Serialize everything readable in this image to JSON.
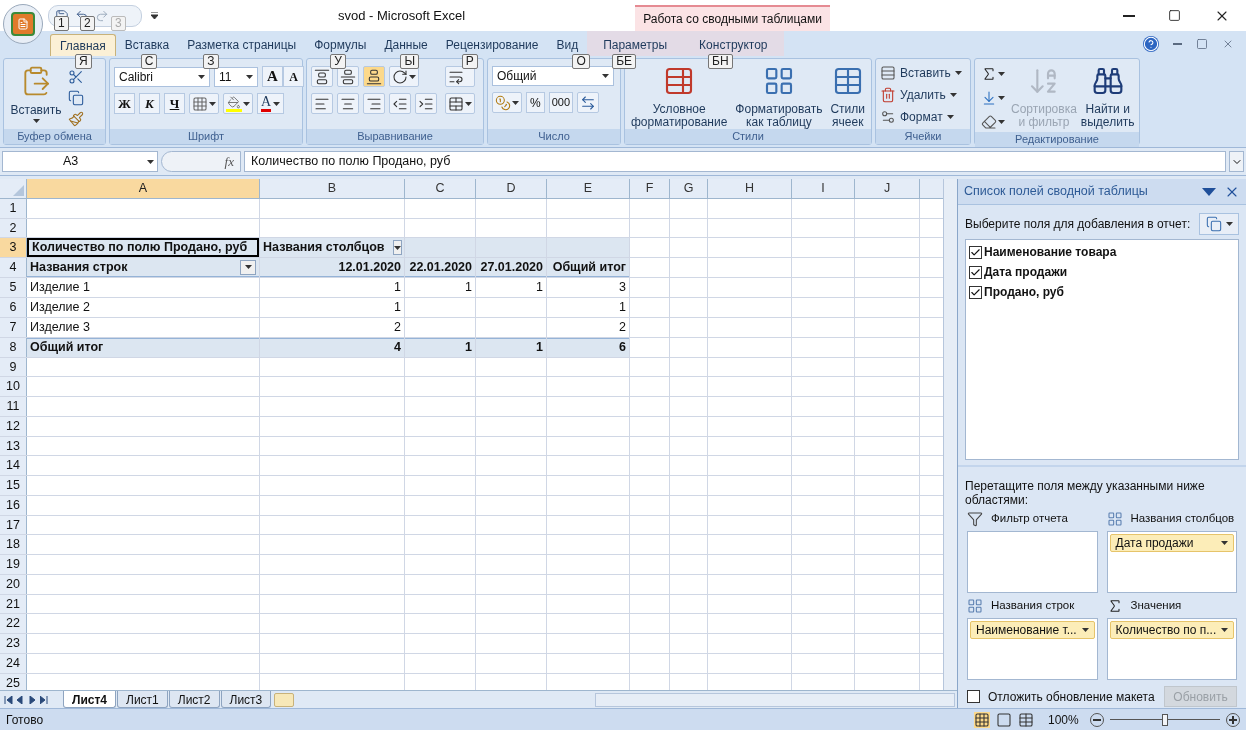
{
  "window": {
    "title": "svod - Microsoft Excel",
    "context_group": "Работа со сводными таблицами"
  },
  "quick_access_keytips": [
    "1",
    "2",
    "3"
  ],
  "ribbon_tabs": [
    {
      "label": "Главная",
      "selected": true,
      "contextual": false,
      "keytip": "Я"
    },
    {
      "label": "Вставка",
      "selected": false,
      "contextual": false,
      "keytip": "С"
    },
    {
      "label": "Разметка страницы",
      "selected": false,
      "contextual": false,
      "keytip": "З"
    },
    {
      "label": "Формулы",
      "selected": false,
      "contextual": false,
      "keytip": "У"
    },
    {
      "label": "Данные",
      "selected": false,
      "contextual": false,
      "keytip": "Ы"
    },
    {
      "label": "Рецензирование",
      "selected": false,
      "contextual": false,
      "keytip": "Р"
    },
    {
      "label": "Вид",
      "selected": false,
      "contextual": false,
      "keytip": "О"
    },
    {
      "label": "Параметры",
      "selected": false,
      "contextual": true,
      "keytip": "БЕ"
    },
    {
      "label": "Конструктор",
      "selected": false,
      "contextual": true,
      "keytip": "БН"
    }
  ],
  "clipboard": {
    "label": "Буфер обмена",
    "paste": "Вставить"
  },
  "font": {
    "label": "Шрифт",
    "name": "Calibri",
    "size": "11",
    "grow": "A",
    "shrink": "A",
    "bold": "Ж",
    "italic": "К",
    "underline": "Ч",
    "color_glyph": "A"
  },
  "alignment": {
    "label": "Выравнивание"
  },
  "number": {
    "label": "Число",
    "format": "Общий",
    "percent": "%",
    "thousands": "000"
  },
  "styles": {
    "label": "Стили",
    "buttons": [
      "Условное\nформатирование",
      "Форматировать\nкак таблицу",
      "Стили\nячеек"
    ]
  },
  "cells": {
    "label": "Ячейки",
    "buttons": [
      "Вставить",
      "Удалить",
      "Формат"
    ]
  },
  "editing": {
    "label": "Редактирование",
    "sort": {
      "label": "Сортировка\nи фильтр",
      "disabled": true
    },
    "find": {
      "label": "Найти и\nвыделить",
      "disabled": false
    }
  },
  "formula_bar": {
    "name_box": "A3",
    "fx": "fx",
    "value": "Количество по полю Продано, руб"
  },
  "sheet": {
    "columns": [
      {
        "label": "A",
        "selected": true
      },
      {
        "label": "B",
        "selected": false
      },
      {
        "label": "C",
        "selected": false
      },
      {
        "label": "D",
        "selected": false
      },
      {
        "label": "E",
        "selected": false
      },
      {
        "label": "F",
        "selected": false
      },
      {
        "label": "G",
        "selected": false
      },
      {
        "label": "H",
        "selected": false
      },
      {
        "label": "I",
        "selected": false
      },
      {
        "label": "J",
        "selected": false
      }
    ],
    "rows": [
      {
        "label": "1",
        "selected": false
      },
      {
        "label": "2",
        "selected": false
      },
      {
        "label": "3",
        "selected": true
      },
      {
        "label": "4",
        "selected": false
      },
      {
        "label": "5",
        "selected": false
      },
      {
        "label": "6",
        "selected": false
      },
      {
        "label": "7",
        "selected": false
      },
      {
        "label": "8",
        "selected": false
      },
      {
        "label": "9",
        "selected": false
      },
      {
        "label": "10",
        "selected": false
      },
      {
        "label": "11",
        "selected": false
      },
      {
        "label": "12",
        "selected": false
      },
      {
        "label": "13",
        "selected": false
      },
      {
        "label": "14",
        "selected": false
      },
      {
        "label": "15",
        "selected": false
      },
      {
        "label": "16",
        "selected": false
      },
      {
        "label": "17",
        "selected": false
      },
      {
        "label": "18",
        "selected": false
      },
      {
        "label": "19",
        "selected": false
      },
      {
        "label": "20",
        "selected": false
      },
      {
        "label": "21",
        "selected": false
      },
      {
        "label": "22",
        "selected": false
      },
      {
        "label": "23",
        "selected": false
      },
      {
        "label": "24",
        "selected": false
      },
      {
        "label": "25",
        "selected": false
      }
    ],
    "pivot": {
      "data_field": "Количество по полю Продано, руб",
      "column_labels": "Названия столбцов",
      "row_labels": "Названия строк",
      "headers": [
        "12.01.2020",
        "22.01.2020",
        "27.01.2020",
        "Общий итог"
      ],
      "items": [
        {
          "label": "Изделие 1",
          "date_1": "1",
          "date_2": "1",
          "date_3": "1",
          "total": "3"
        },
        {
          "label": "Изделие 2",
          "date_1": "1",
          "total": "1"
        },
        {
          "label": "Изделие 3",
          "date_1": "2",
          "total": "2"
        }
      ],
      "grand_total": {
        "label": "Общий итог",
        "date_1": "4",
        "date_2": "1",
        "date_3": "1",
        "total": "6"
      }
    }
  },
  "sheet_tabs": [
    {
      "label": "Лист4",
      "selected": true
    },
    {
      "label": "Лист1",
      "selected": false
    },
    {
      "label": "Лист2",
      "selected": false
    },
    {
      "label": "Лист3",
      "selected": false
    }
  ],
  "field_list": {
    "title": "Список полей сводной таблицы",
    "prompt": "Выберите поля для добавления в отчет:",
    "fields": [
      {
        "label": "Наименование товара",
        "checked": true
      },
      {
        "label": "Дата продажи",
        "checked": true
      },
      {
        "label": "Продано, руб",
        "checked": true
      }
    ],
    "drag_hint": "Перетащите поля между указанными ниже областями:",
    "areas": [
      {
        "kind": "filter",
        "title": "Фильтр отчета"
      },
      {
        "kind": "columns",
        "title": "Названия столбцов",
        "items": [
          {
            "label": "Дата продажи"
          }
        ]
      },
      {
        "kind": "rows",
        "title": "Названия строк",
        "items": [
          {
            "label": "Наименование т..."
          }
        ]
      },
      {
        "kind": "values",
        "title": "Значения",
        "items": [
          {
            "label": "Количество по п..."
          }
        ]
      }
    ],
    "defer": {
      "label": "Отложить обновление макета",
      "checked": false
    },
    "update": {
      "label": "Обновить",
      "disabled": true
    }
  },
  "status_bar": {
    "status": "Готово",
    "zoom": "100%",
    "level": 0.5
  }
}
